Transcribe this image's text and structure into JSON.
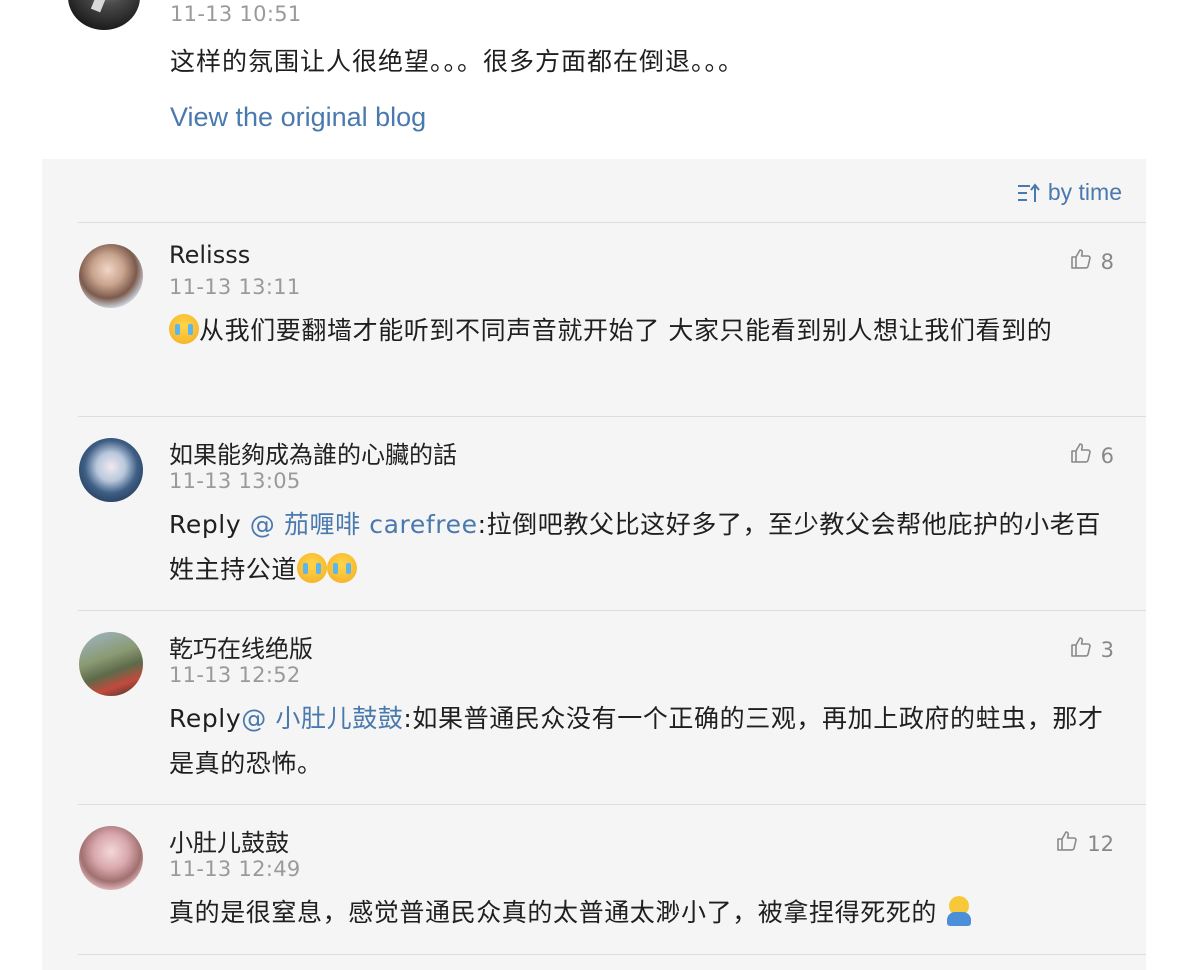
{
  "post": {
    "time": "11-13 10:51",
    "text": "这样的氛围让人很绝望。。。很多方面都在倒退。。。",
    "view_original_label": "View the original blog"
  },
  "comments_header": {
    "sort_label": "by time",
    "sort_icon": "sort-icon"
  },
  "comments": [
    {
      "username": "Relisss",
      "time": "11-13 13:11",
      "likes": "8",
      "body_text": "从我们要翻墙才能听到不同声音就开始了 大家只能看到别人想让我们看到的",
      "emoji": "crying-face-emoji"
    },
    {
      "username": "如果能夠成為誰的心臟的話",
      "time": "11-13 13:05",
      "likes": "6",
      "reply_prefix": "Reply ",
      "mention": "@ 茄喱啡 carefree",
      "body_text": ":拉倒吧教父比这好多了，至少教父会帮他庇护的小老百姓主持公道",
      "emoji": "crying-face-emoji"
    },
    {
      "username": "乾巧在线绝版",
      "time": "11-13 12:52",
      "likes": "3",
      "reply_prefix": "Reply",
      "mention": "@ 小肚儿鼓鼓",
      "body_text": ":如果普通民众没有一个正确的三观，再加上政府的蛀虫，那才是真的恐怖。"
    },
    {
      "username": "小肚儿鼓鼓",
      "time": "11-13 12:49",
      "likes": "12",
      "body_text": "真的是很窒息，感觉普通民众真的太普通太渺小了，被拿捏得死死的",
      "emoji": "sweating-person-emoji"
    }
  ],
  "colors": {
    "link": "#4a79ad",
    "meta": "#9a9a9a",
    "panel_bg": "#f5f5f5",
    "text": "#1f1f1f"
  }
}
